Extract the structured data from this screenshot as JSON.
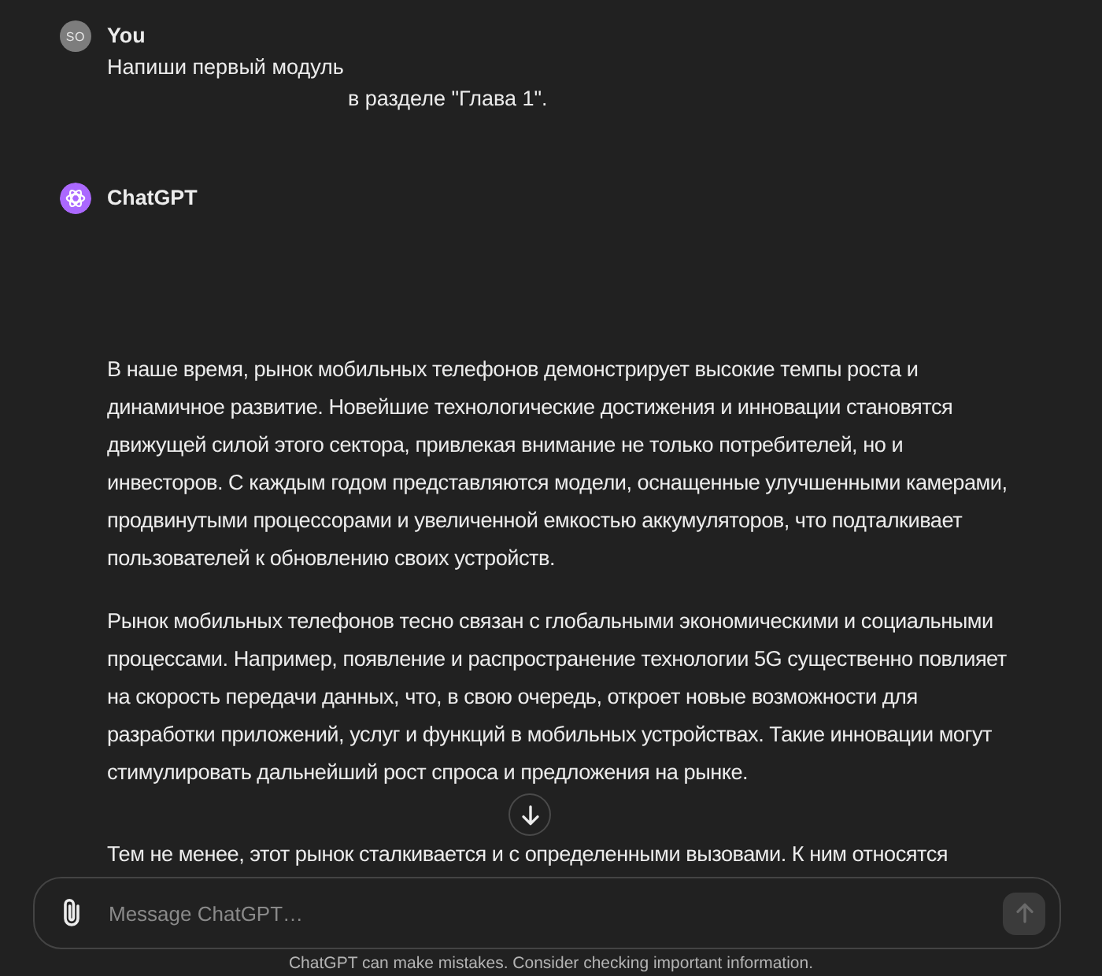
{
  "conversation": [
    {
      "kind": "user",
      "author": "You",
      "initials": "SO",
      "lines": [
        "Напиши первый модуль",
        "в разделе \"Глава 1\"."
      ]
    },
    {
      "kind": "assistant",
      "author": "ChatGPT",
      "paragraphs": [
        "В наше время, рынок мобильных телефонов демонстрирует высокие темпы роста и динамичное развитие. Новейшие технологические достижения и инновации становятся движущей силой этого сектора, привлекая внимание не только потребителей, но и инвесторов. С каждым годом представляются модели, оснащенные улучшенными камерами, продвинутыми процессорами и увеличенной емкостью аккумуляторов, что подталкивает пользователей к обновлению своих устройств.",
        "Рынок мобильных телефонов тесно связан с глобальными экономическими и социальными процессами. Например, появление и распространение технологии 5G существенно повлияет на скорость передачи данных, что, в свою очередь, откроет новые возможности для разработки приложений, услуг и функций в мобильных устройствах. Такие инновации могут стимулировать дальнейший рост спроса и предложения на рынке.",
        "Тем не менее, этот рынок сталкивается и с определенными вызовами. К ним относятся"
      ]
    }
  ],
  "composer": {
    "placeholder": "Message ChatGPT…",
    "send_button": {
      "disabled": true
    }
  },
  "disclaimer": "ChatGPT can make mistakes. Consider checking important information."
}
